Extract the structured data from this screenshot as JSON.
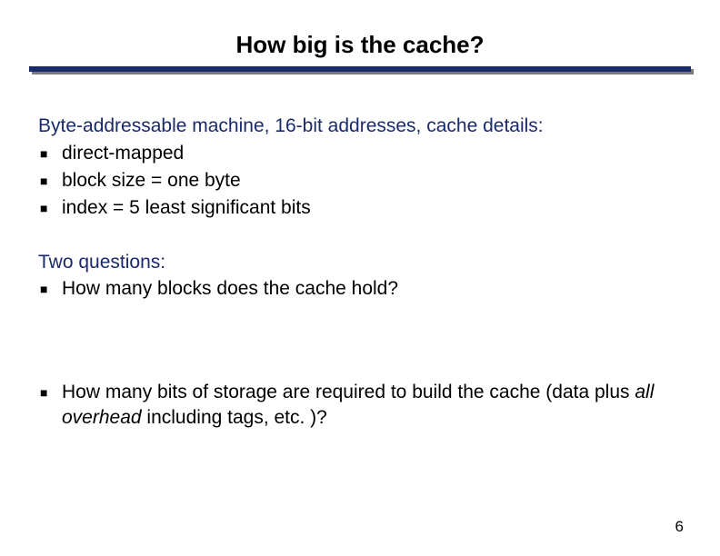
{
  "title": "How big is the cache?",
  "section1": {
    "lead": "Byte-addressable machine, 16-bit addresses, cache details:",
    "items": [
      " direct-mapped",
      "block size = one byte",
      "index = 5 least significant bits"
    ]
  },
  "section2": {
    "lead": "Two questions:",
    "q1": "How many blocks does the cache hold?",
    "q2_a": "How many bits of storage are required to build the cache (data plus ",
    "q2_b": "all overhead",
    "q2_c": " including tags, etc. )?"
  },
  "page_number": "6",
  "colors": {
    "accent": "#1a2a6b"
  }
}
